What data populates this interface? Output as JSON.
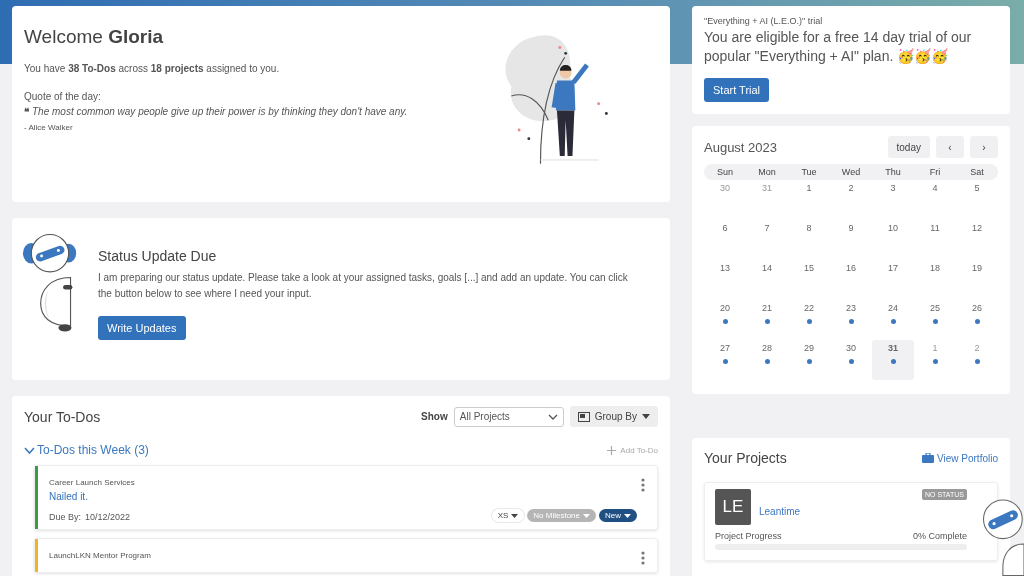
{
  "welcome": {
    "greeting": "Welcome",
    "name": "Gloria",
    "summary": "You have **38 To-Dos** across **18 projects** assigned to you.",
    "quote_label": "Quote of the day:",
    "quote_mark": "❝",
    "quote": "The most common way people give up their power is by thinking they don't have any.",
    "author": "- Alice Walker"
  },
  "status_update": {
    "title": "Status Update Due",
    "text": "I am preparing our status update. Please take a look at your assigned tasks, goals [...] and add an update. You can click the button below to see where I need your input.",
    "button": "Write Updates"
  },
  "todos": {
    "title": "Your To-Dos",
    "show_label": "Show",
    "filter": "All Projects",
    "group_by": "Group By",
    "section": {
      "title": "To-Dos this Week (3)",
      "expanded": true
    },
    "add_label": "Add To-Do",
    "items": [
      {
        "project": "Career Launch Services",
        "title": "Nailed it.",
        "due_label": "Due By:",
        "due_date": "10/12/2022",
        "color": "#3d9a47",
        "tags": [
          {
            "kind": "effort",
            "label": "XS"
          },
          {
            "kind": "milestone",
            "label": "No Milestone"
          },
          {
            "kind": "status",
            "label": "New"
          }
        ]
      },
      {
        "project": "LaunchLKN Mentor Program",
        "color": "#f0b429"
      }
    ]
  },
  "trial": {
    "caption": "\"Everything + AI (L.E.O.)\" trial",
    "message": "You are eligible for a free 14 day trial of our popular \"Everything + AI\" plan. 🥳🥳🥳",
    "button": "Start Trial"
  },
  "calendar": {
    "month": "August 2023",
    "today_button": "today",
    "prev_button": "‹",
    "next_button": "›",
    "weekdays": [
      "Sun",
      "Mon",
      "Tue",
      "Wed",
      "Thu",
      "Fri",
      "Sat"
    ],
    "weeks": [
      [
        {
          "day": "30",
          "muted": true,
          "dot": false,
          "selected": false
        },
        {
          "day": "31",
          "muted": true,
          "dot": false,
          "selected": false
        },
        {
          "day": "1",
          "muted": false,
          "dot": false,
          "selected": false
        },
        {
          "day": "2",
          "muted": false,
          "dot": false,
          "selected": false
        },
        {
          "day": "3",
          "muted": false,
          "dot": false,
          "selected": false
        },
        {
          "day": "4",
          "muted": false,
          "dot": false,
          "selected": false
        },
        {
          "day": "5",
          "muted": false,
          "dot": false,
          "selected": false
        }
      ],
      [
        {
          "day": "6",
          "muted": false,
          "dot": false,
          "selected": false
        },
        {
          "day": "7",
          "muted": false,
          "dot": false,
          "selected": false
        },
        {
          "day": "8",
          "muted": false,
          "dot": false,
          "selected": false
        },
        {
          "day": "9",
          "muted": false,
          "dot": false,
          "selected": false
        },
        {
          "day": "10",
          "muted": false,
          "dot": false,
          "selected": false
        },
        {
          "day": "11",
          "muted": false,
          "dot": false,
          "selected": false
        },
        {
          "day": "12",
          "muted": false,
          "dot": false,
          "selected": false
        }
      ],
      [
        {
          "day": "13",
          "muted": false,
          "dot": false,
          "selected": false
        },
        {
          "day": "14",
          "muted": false,
          "dot": false,
          "selected": false
        },
        {
          "day": "15",
          "muted": false,
          "dot": false,
          "selected": false
        },
        {
          "day": "16",
          "muted": false,
          "dot": false,
          "selected": false
        },
        {
          "day": "17",
          "muted": false,
          "dot": false,
          "selected": false
        },
        {
          "day": "18",
          "muted": false,
          "dot": false,
          "selected": false
        },
        {
          "day": "19",
          "muted": false,
          "dot": false,
          "selected": false
        }
      ],
      [
        {
          "day": "20",
          "muted": false,
          "dot": true,
          "selected": false
        },
        {
          "day": "21",
          "muted": false,
          "dot": true,
          "selected": false
        },
        {
          "day": "22",
          "muted": false,
          "dot": true,
          "selected": false
        },
        {
          "day": "23",
          "muted": false,
          "dot": true,
          "selected": false
        },
        {
          "day": "24",
          "muted": false,
          "dot": true,
          "selected": false
        },
        {
          "day": "25",
          "muted": false,
          "dot": true,
          "selected": false
        },
        {
          "day": "26",
          "muted": false,
          "dot": true,
          "selected": false
        }
      ],
      [
        {
          "day": "27",
          "muted": false,
          "dot": true,
          "selected": false
        },
        {
          "day": "28",
          "muted": false,
          "dot": true,
          "selected": false
        },
        {
          "day": "29",
          "muted": false,
          "dot": true,
          "selected": false
        },
        {
          "day": "30",
          "muted": false,
          "dot": true,
          "selected": false
        },
        {
          "day": "31",
          "muted": false,
          "dot": true,
          "selected": true
        },
        {
          "day": "1",
          "muted": true,
          "dot": true,
          "selected": false
        },
        {
          "day": "2",
          "muted": true,
          "dot": true,
          "selected": false
        }
      ]
    ]
  },
  "projects": {
    "title": "Your Projects",
    "link": "View Portfolio",
    "items": [
      {
        "initials": "LE",
        "name": "Leantime",
        "status": "NO STATUS",
        "progress_label": "Project Progress",
        "progress_text": "0% Complete",
        "level": 0
      }
    ]
  }
}
